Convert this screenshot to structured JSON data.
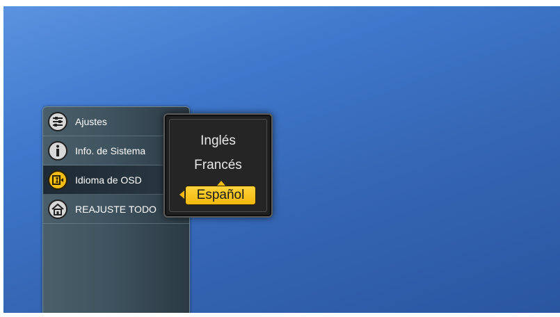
{
  "menu": {
    "items": [
      {
        "label": "Ajustes",
        "icon": "settings-sliders-icon"
      },
      {
        "label": "Info. de Sistema",
        "icon": "info-icon"
      },
      {
        "label": "Idioma de OSD",
        "icon": "language-icon"
      },
      {
        "label": "REAJUSTE TODO",
        "icon": "home-reset-icon"
      }
    ],
    "selected_index": 2
  },
  "language_popup": {
    "options": [
      "Inglés",
      "Francés",
      "Español"
    ],
    "selected": "Español"
  },
  "colors": {
    "background_top": "#5b93e0",
    "background_bottom": "#2a56a0",
    "accent": "#f1b90d"
  }
}
